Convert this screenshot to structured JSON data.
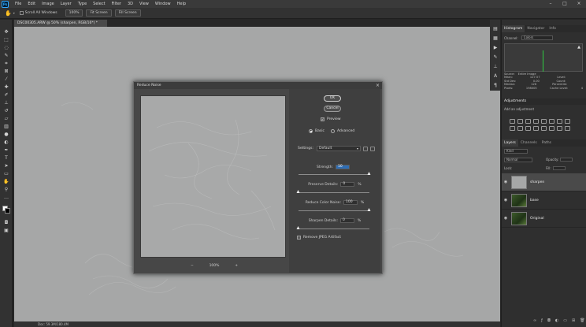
{
  "menubar": {
    "items": [
      "File",
      "Edit",
      "Image",
      "Layer",
      "Type",
      "Select",
      "Filter",
      "3D",
      "View",
      "Window",
      "Help"
    ]
  },
  "options": {
    "scroll_all_windows": "Scroll All Windows",
    "zoom_value": "100%",
    "fit_screen": "Fit Screen",
    "fill_screen": "Fill Screen"
  },
  "document": {
    "tab_title": "DSC00305.ARW @ 50% (sharpen, RGB/16*) *"
  },
  "status": {
    "text": "Doc: 59.3M/180.4M"
  },
  "dialog": {
    "title": "Reduce Noise",
    "ok": "OK",
    "cancel": "Cancel",
    "preview_label": "Preview",
    "mode_basic": "Basic",
    "mode_advanced": "Advanced",
    "settings_label": "Settings:",
    "settings_value": "Default",
    "zoom": "100%",
    "zoom_out": "−",
    "zoom_in": "+",
    "strength": {
      "label": "Strength:",
      "value": "10",
      "unit": "",
      "fraction": 1.0
    },
    "preserve": {
      "label": "Preserve Details:",
      "value": "0",
      "unit": "%",
      "fraction": 0.0
    },
    "color_noise": {
      "label": "Reduce Color Noise:",
      "value": "100",
      "unit": "%",
      "fraction": 1.0
    },
    "sharpen": {
      "label": "Sharpen Details:",
      "value": "0",
      "unit": "%",
      "fraction": 0.0
    },
    "jpeg_label": "Remove JPEG Artifact"
  },
  "panels": {
    "top_tabs": [
      "Histogram",
      "Navigator",
      "Info"
    ],
    "channel_label": "Channel:",
    "channel_value": "Colors",
    "source_label": "Source:",
    "source_value": "Entire Image",
    "stats": [
      [
        "Mean:",
        "127.57",
        "Level:",
        ""
      ],
      [
        "Std Dev:",
        "0.00",
        "Count:",
        ""
      ],
      [
        "Median:",
        "126",
        "Percentile:",
        ""
      ],
      [
        "Pixels:",
        "198005",
        "Cache Level:",
        "4"
      ]
    ],
    "adjustments_title": "Adjustments",
    "adjustments_hint": "Add an adjustment",
    "layer_tabs": [
      "Layers",
      "Channels",
      "Paths"
    ],
    "kind": "Kind",
    "blend_mode": "Normal",
    "opacity_label": "Opacity:",
    "lock_label": "Lock:",
    "fill_label": "Fill:",
    "layers": [
      {
        "name": "sharpen",
        "selected": true
      },
      {
        "name": "base",
        "selected": false
      },
      {
        "name": "Original",
        "selected": false
      }
    ]
  },
  "colors": {
    "accent": "#31a8ff",
    "selection": "#2f6eb5",
    "canvas": "#a6a7a7"
  }
}
